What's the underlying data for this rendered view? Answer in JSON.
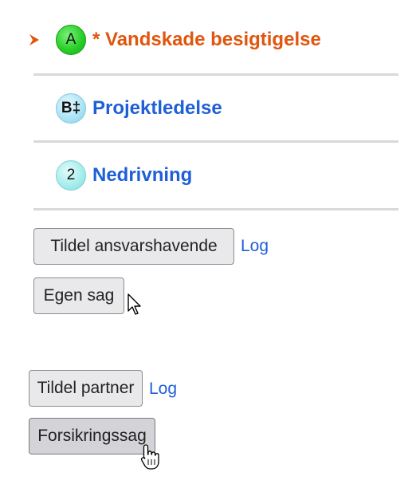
{
  "stages": [
    {
      "badge": "A",
      "prefix": "* ",
      "label": "Vandskade besigtigelse",
      "active": true,
      "color": "#e0560e"
    },
    {
      "badge": "B‡",
      "label": "Projektledelse",
      "active": false,
      "color": "#1e5fd8"
    },
    {
      "badge": "2",
      "label": "Nedrivning",
      "active": false,
      "color": "#1e5fd8"
    }
  ],
  "responsible": {
    "assign_label": "Tildel ansvarshavende",
    "log_label": "Log",
    "own_case_label": "Egen sag"
  },
  "partner": {
    "assign_label": "Tildel partner",
    "log_label": "Log",
    "insurance_case_label": "Forsikringssag"
  },
  "cursors": {
    "arrow_icon": "mouse-arrow-cursor",
    "hand_icon": "hand-pointer-cursor"
  }
}
